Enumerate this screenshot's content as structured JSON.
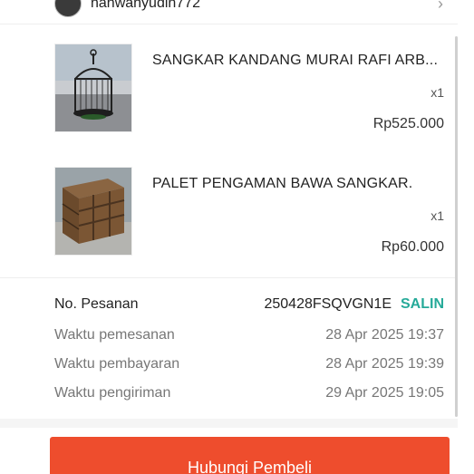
{
  "seller": {
    "name": "nanwahyudin772"
  },
  "products": [
    {
      "title": "SANGKAR KANDANG MURAI RAFI ARB...",
      "quantity": "x1",
      "price": "Rp525.000",
      "image_icon": "birdcage-photo"
    },
    {
      "title": "PALET PENGAMAN BAWA SANGKAR.",
      "quantity": "x1",
      "price": "Rp60.000",
      "image_icon": "wooden-pallet-photo"
    }
  ],
  "order_info": {
    "order_number_label": "No. Pesanan",
    "order_number": "250428FSQVGN1E",
    "copy_label": "SALIN",
    "order_time_label": "Waktu pemesanan",
    "order_time": "28 Apr 2025 19:37",
    "payment_time_label": "Waktu pembayaran",
    "payment_time": "28 Apr 2025 19:39",
    "shipping_time_label": "Waktu pengiriman",
    "shipping_time": "29 Apr 2025 19:05"
  },
  "actions": {
    "contact_buyer_label": "Hubungi Pembeli"
  },
  "colors": {
    "accent": "#ee4d2d",
    "copy_link": "#26aa99",
    "secondary_text": "#777777"
  }
}
